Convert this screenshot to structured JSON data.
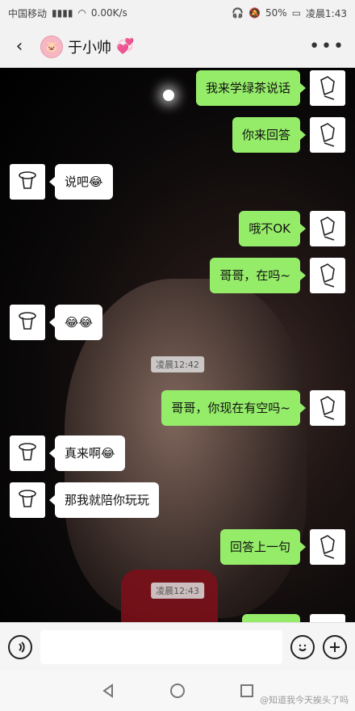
{
  "status_bar": {
    "carrier": "中国移动",
    "network_speed": "0.00K/s",
    "battery": "50%",
    "time": "凌晨1:43"
  },
  "header": {
    "title": "于小帅",
    "back_icon": "chevron-left-icon",
    "more_icon": "more-icon"
  },
  "messages": [
    {
      "side": "right",
      "text": "我来学绿茶说话"
    },
    {
      "side": "right",
      "text": "你来回答"
    },
    {
      "side": "left",
      "text": "说吧😂"
    },
    {
      "side": "right",
      "text": "哦不OK"
    },
    {
      "side": "right",
      "text": "哥哥，在吗~"
    },
    {
      "side": "left",
      "text": "😂😂"
    },
    {
      "type": "time",
      "text": "凌晨12:42"
    },
    {
      "side": "right",
      "text": "哥哥，你现在有空吗~"
    },
    {
      "side": "left",
      "text": "真来啊😂"
    },
    {
      "side": "left",
      "text": "那我就陪你玩玩"
    },
    {
      "side": "right",
      "text": "回答上一句"
    },
    {
      "type": "time",
      "text": "凌晨12:43"
    }
  ],
  "input_bar": {
    "voice_icon": "voice-icon",
    "emoji_icon": "emoji-icon",
    "plus_icon": "plus-icon"
  },
  "navbar": {
    "back": "back-triangle-icon",
    "home": "home-circle-icon",
    "recent": "recent-square-icon"
  },
  "watermark": "@知道我今天挨头了吗"
}
